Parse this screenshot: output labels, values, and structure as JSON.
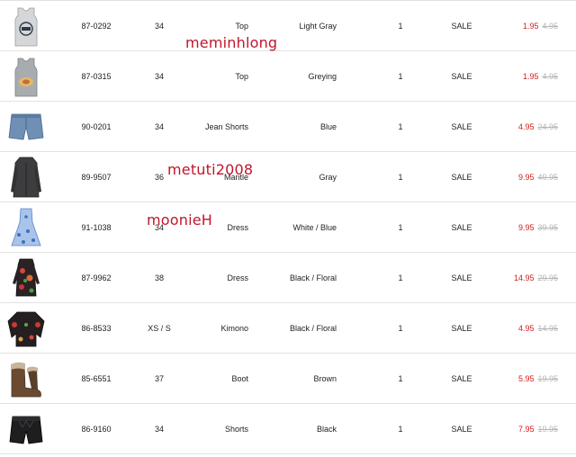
{
  "rows": [
    {
      "article": "87-0292",
      "size": "34",
      "name": "Top",
      "color": "Light Gray",
      "qty": "1",
      "status": "SALE",
      "sale_price": "1.95",
      "old_price": "4.95",
      "thumb_icon": "tank-top-light-gray-icon"
    },
    {
      "article": "87-0315",
      "size": "34",
      "name": "Top",
      "color": "Greying",
      "qty": "1",
      "status": "SALE",
      "sale_price": "1.95",
      "old_price": "4.95",
      "thumb_icon": "tank-top-gray-icon"
    },
    {
      "article": "90-0201",
      "size": "34",
      "name": "Jean Shorts",
      "color": "Blue",
      "qty": "1",
      "status": "SALE",
      "sale_price": "4.95",
      "old_price": "24.95",
      "thumb_icon": "jean-shorts-icon"
    },
    {
      "article": "89-9507",
      "size": "36",
      "name": "Mantle",
      "color": "Gray",
      "qty": "1",
      "status": "SALE",
      "sale_price": "9.95",
      "old_price": "49.95",
      "thumb_icon": "coat-icon"
    },
    {
      "article": "91-1038",
      "size": "34",
      "name": "Dress",
      "color": "White / Blue",
      "qty": "1",
      "status": "SALE",
      "sale_price": "9.95",
      "old_price": "39.95",
      "thumb_icon": "blue-dress-icon"
    },
    {
      "article": "87-9962",
      "size": "38",
      "name": "Dress",
      "color": "Black / Floral",
      "qty": "1",
      "status": "SALE",
      "sale_price": "14.95",
      "old_price": "29.95",
      "thumb_icon": "floral-dress-icon"
    },
    {
      "article": "86-8533",
      "size": "XS / S",
      "name": "Kimono",
      "color": "Black / Floral",
      "qty": "1",
      "status": "SALE",
      "sale_price": "4.95",
      "old_price": "14.95",
      "thumb_icon": "kimono-icon"
    },
    {
      "article": "85-6551",
      "size": "37",
      "name": "Boot",
      "color": "Brown",
      "qty": "1",
      "status": "SALE",
      "sale_price": "5.95",
      "old_price": "19.95",
      "thumb_icon": "boot-icon"
    },
    {
      "article": "86-9160",
      "size": "34",
      "name": "Shorts",
      "color": "Black",
      "qty": "1",
      "status": "SALE",
      "sale_price": "7.95",
      "old_price": "19.95",
      "thumb_icon": "black-shorts-icon"
    }
  ],
  "watermarks": {
    "first": "meminhlong",
    "second": "metuti2008",
    "third": "moonieH"
  },
  "colors": {
    "sale_price": "#d21d1d",
    "old_price": "#b5b5b5",
    "watermark": "#c0162a",
    "divider": "#e2e2e2"
  }
}
